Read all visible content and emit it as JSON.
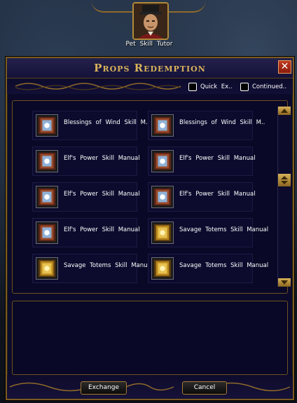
{
  "npc": {
    "name": "Pet Skill Tutor",
    "portrait_icon": "npc-portrait-icon"
  },
  "dialog": {
    "title": "Props Redemption",
    "close_icon": "close-icon",
    "options": {
      "quick_exchange": {
        "label": "Quick Ex..",
        "checked": false
      },
      "continued": {
        "label": "Continued..",
        "checked": false
      }
    },
    "items": [
      {
        "name": "Blessings of Wind Skill M..",
        "icon": "blue-skill-book-icon"
      },
      {
        "name": "Blessings of Wind Skill M..",
        "icon": "blue-skill-book-icon"
      },
      {
        "name": "Elf's Power Skill Manual",
        "icon": "blue-skill-book-icon"
      },
      {
        "name": "Elf's Power Skill Manual",
        "icon": "blue-skill-book-icon"
      },
      {
        "name": "Elf's Power Skill Manual",
        "icon": "blue-skill-book-icon"
      },
      {
        "name": "Elf's Power Skill Manual",
        "icon": "blue-skill-book-icon"
      },
      {
        "name": "Elf's Power Skill Manual",
        "icon": "blue-skill-book-icon"
      },
      {
        "name": "Savage Totems Skill Manual",
        "icon": "gold-skill-book-icon"
      },
      {
        "name": "Savage Totems Skill Manual",
        "icon": "gold-skill-book-icon"
      },
      {
        "name": "Savage Totems Skill Manual",
        "icon": "gold-skill-book-icon"
      }
    ],
    "scrollbar": {
      "up_icon": "scroll-up-icon",
      "down_icon": "scroll-down-icon",
      "thumb_icon": "scroll-thumb-icon"
    },
    "buttons": {
      "exchange": "Exchange",
      "cancel": "Cancel"
    }
  },
  "colors": {
    "accent_gold": "#d9b35a",
    "panel_bg": "#0b0a2a",
    "border_gold": "#7c5b20",
    "close_red": "#c23a1f"
  }
}
